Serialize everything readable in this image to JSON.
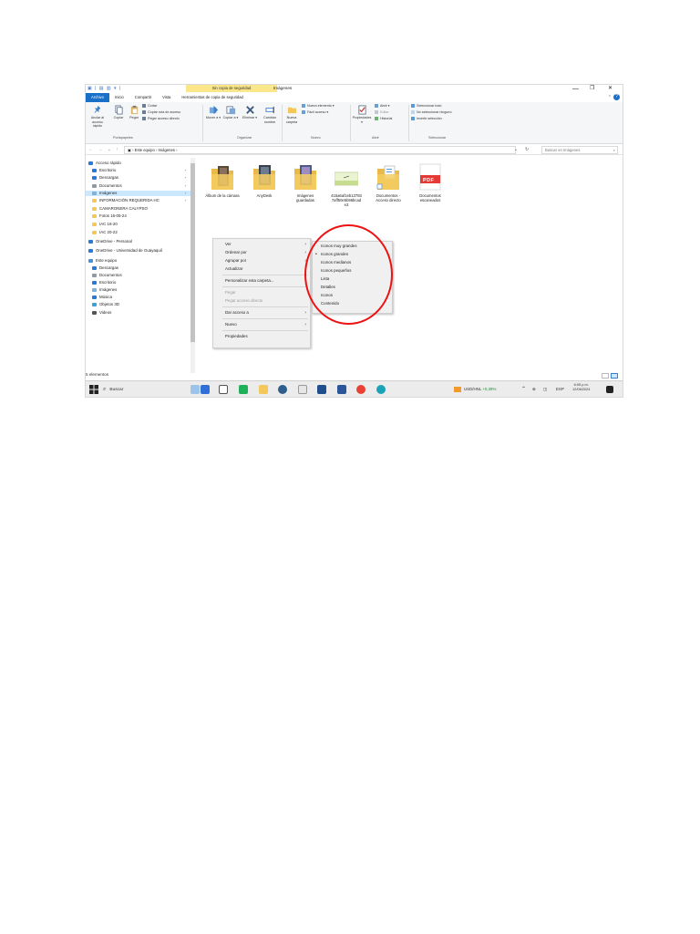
{
  "window": {
    "title": "Imágenes",
    "context_tab": "Sin copia de seguridad",
    "quick_access_toolbar": "▣ | ▤ ▥ ▾ |",
    "minimize": "—",
    "maximize": "❐",
    "close": "✕",
    "collapse_ribbon": "⌃",
    "help": "?"
  },
  "ribbon_tabs": [
    "Archivo",
    "Inicio",
    "Compartir",
    "Vista",
    "Herramientas de copia de seguridad"
  ],
  "ribbon": {
    "anclar": "Anclar al acceso rápido",
    "copiar": "Copiar",
    "pegar": "Pegar",
    "cortar": "Cortar",
    "copiar_ruta": "Copiar ruta de acceso",
    "pegar_acceso": "Pegar acceso directo",
    "mover_a": "Mover a ▾",
    "copiar_a": "Copiar a ▾",
    "eliminar": "Eliminar ▾",
    "cambiar_nombre": "Cambiar nombre",
    "nueva_carpeta": "Nueva carpeta",
    "nuevo_elemento": "Nuevo elemento ▾",
    "facil_acceso": "Fácil acceso ▾",
    "propiedades": "Propiedades ▾",
    "abrir": "Abrir ▾",
    "editar": "Editar",
    "historial": "Historial",
    "seleccionar_todo": "Seleccionar todo",
    "no_seleccionar": "No seleccionar ninguno",
    "invertir": "Invertir selección",
    "groups": [
      "Portapapeles",
      "Organizar",
      "Nuevo",
      "Abrir",
      "Seleccionar"
    ]
  },
  "address": {
    "nav": "← → ⌄ ↑",
    "path": "▣ › Este equipo › Imágenes ›",
    "dropdown": "⌄",
    "refresh": "↻",
    "search_placeholder": "Buscar en Imágenes",
    "search_icon": "⌕"
  },
  "sidebar": [
    {
      "label": "Acceso rápido",
      "icon": "star-icon",
      "color": "#2b79d6",
      "pin": ""
    },
    {
      "label": "Escritorio",
      "icon": "desktop-icon",
      "color": "#2b79d6",
      "pin": "⋆"
    },
    {
      "label": "Descargas",
      "icon": "download-icon",
      "color": "#2b79d6",
      "pin": "⋆"
    },
    {
      "label": "Documentos",
      "icon": "document-icon",
      "color": "#8e9aa8",
      "pin": "⋆"
    },
    {
      "label": "Imágenes",
      "icon": "pictures-icon",
      "color": "#7fb0d9",
      "pin": "⋆"
    },
    {
      "label": "INFORMACIÓN REQUERIDA HC",
      "icon": "folder-icon",
      "color": "#f3c75a",
      "pin": "⋆"
    },
    {
      "label": "CAMARONERA CALYPSO",
      "icon": "folder-icon",
      "color": "#f3c75a",
      "pin": ""
    },
    {
      "label": "Fotos 16-05-24",
      "icon": "folder-icon",
      "color": "#f3c75a",
      "pin": ""
    },
    {
      "label": "IAC 16-20",
      "icon": "folder-icon",
      "color": "#f3c75a",
      "pin": ""
    },
    {
      "label": "IAC 20-22",
      "icon": "folder-icon",
      "color": "#f3c75a",
      "pin": ""
    },
    {
      "label": "OneDrive - Personal",
      "icon": "cloud-icon",
      "color": "#2b79d6",
      "pin": ""
    },
    {
      "label": "OneDrive - Universidad de Guayaquil",
      "icon": "cloud-icon",
      "color": "#2b79d6",
      "pin": ""
    },
    {
      "label": "Este equipo",
      "icon": "computer-icon",
      "color": "#4a90d9",
      "pin": ""
    },
    {
      "label": "Descargas",
      "icon": "download-icon",
      "color": "#2b79d6",
      "pin": ""
    },
    {
      "label": "Documentos",
      "icon": "document-icon",
      "color": "#8e9aa8",
      "pin": ""
    },
    {
      "label": "Escritorio",
      "icon": "desktop-icon",
      "color": "#2b79d6",
      "pin": ""
    },
    {
      "label": "Imágenes",
      "icon": "pictures-icon",
      "color": "#7fb0d9",
      "pin": ""
    },
    {
      "label": "Música",
      "icon": "music-icon",
      "color": "#2b79d6",
      "pin": ""
    },
    {
      "label": "Objetos 3D",
      "icon": "cube-icon",
      "color": "#3aa0d8",
      "pin": ""
    },
    {
      "label": "Videos",
      "icon": "video-icon",
      "color": "#555555",
      "pin": ""
    }
  ],
  "status": "6 elementos",
  "files": [
    {
      "label": "Álbum de la cámara"
    },
    {
      "label": "AnyDesk"
    },
    {
      "label": "Imágenes guardadas"
    },
    {
      "label": "415a6af1eb13783 7aff50e5b96bcad e3"
    },
    {
      "label": "Documentos - Acceso directo"
    },
    {
      "label": "Documentos escaneados",
      "badge": "PDF"
    }
  ],
  "context_menu": {
    "ver": "Ver",
    "ordenar": "Ordenar por",
    "agrupar": "Agrupar por",
    "actualizar": "Actualizar",
    "personalizar": "Personalizar esta carpeta...",
    "pegar": "Pegar",
    "pegar_acceso": "Pegar acceso directo",
    "dar_acceso": "Dar acceso a",
    "nuevo": "Nuevo",
    "propiedades": "Propiedades",
    "arrow": "›"
  },
  "view_submenu": {
    "items": [
      "Iconos muy grandes",
      "Iconos grandes",
      "Iconos medianos",
      "Iconos pequeños",
      "Lista",
      "Detalles",
      "Iconos",
      "Contenido"
    ],
    "bullet": "•"
  },
  "taskbar": {
    "search": "Buscar",
    "ticker": "USD/HNL",
    "ticker_change": "+0,39%",
    "lang": "ESP",
    "time": "6:05 p.m.",
    "date": "12/06/2024",
    "tray_up": "⌃"
  }
}
